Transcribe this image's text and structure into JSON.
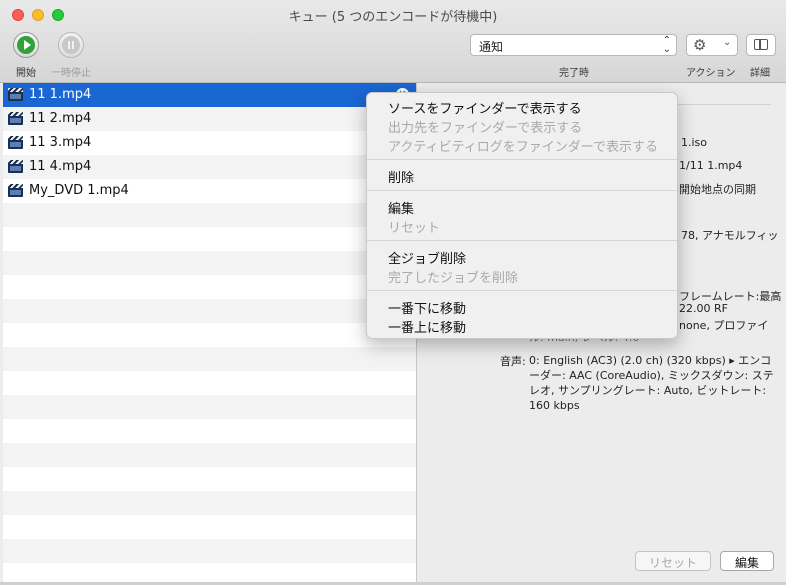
{
  "window": {
    "title": "キュー (5 つのエンコードが待機中)"
  },
  "toolbar": {
    "start_label": "開始",
    "pause_label": "一時停止",
    "when_done_label": "完了時",
    "when_done_value": "通知",
    "action_label": "アクション",
    "detail_label": "詳細"
  },
  "queue": {
    "items": [
      {
        "name": "11 1.mp4",
        "selected": true
      },
      {
        "name": "11 2.mp4"
      },
      {
        "name": "11 3.mp4"
      },
      {
        "name": "11 4.mp4"
      },
      {
        "name": "My_DVD 1.mp4"
      }
    ],
    "remove_glyph": "✕"
  },
  "detail": {
    "frag1": "1.iso",
    "frag2": "1/11 1.mp4",
    "frag3": "開始地点の同期",
    "frag4": "78, アナモルフィッ",
    "frag5": "フレームレート:最高",
    "frag6": "22.00 RF",
    "frag7": "none, プロファイ",
    "frag8": "ル: main, レベル: 4.0",
    "audio_label": "音声:",
    "audio_text": "0: English (AC3) (2.0 ch) (320 kbps) ▸ エンコーダー: AAC (CoreAudio), ミックスダウン: ステレオ, サンプリングレート: Auto, ビットレート: 160 kbps",
    "reset_button": "リセット",
    "edit_button": "編集"
  },
  "context_menu": {
    "items": [
      {
        "label": "ソースをファインダーで表示する",
        "enabled": true
      },
      {
        "label": "出力先をファインダーで表示する",
        "enabled": false
      },
      {
        "label": "アクティビティログをファインダーで表示する",
        "enabled": false
      },
      {
        "label": "削除",
        "enabled": true
      },
      {
        "label": "編集",
        "enabled": true
      },
      {
        "label": "リセット",
        "enabled": false
      },
      {
        "label": "全ジョブ削除",
        "enabled": true
      },
      {
        "label": "完了したジョブを削除",
        "enabled": false
      },
      {
        "label": "一番下に移動",
        "enabled": true
      },
      {
        "label": "一番上に移動",
        "enabled": true
      }
    ]
  },
  "colors": {
    "selection": "#1a66d2",
    "start_green": "#2fa23a"
  },
  "icons": [
    "start-icon",
    "pause-icon",
    "gear-icon",
    "chevron-down-icon",
    "sidebar-panel-icon",
    "film-icon",
    "remove-icon",
    "updown-arrows-icon"
  ]
}
